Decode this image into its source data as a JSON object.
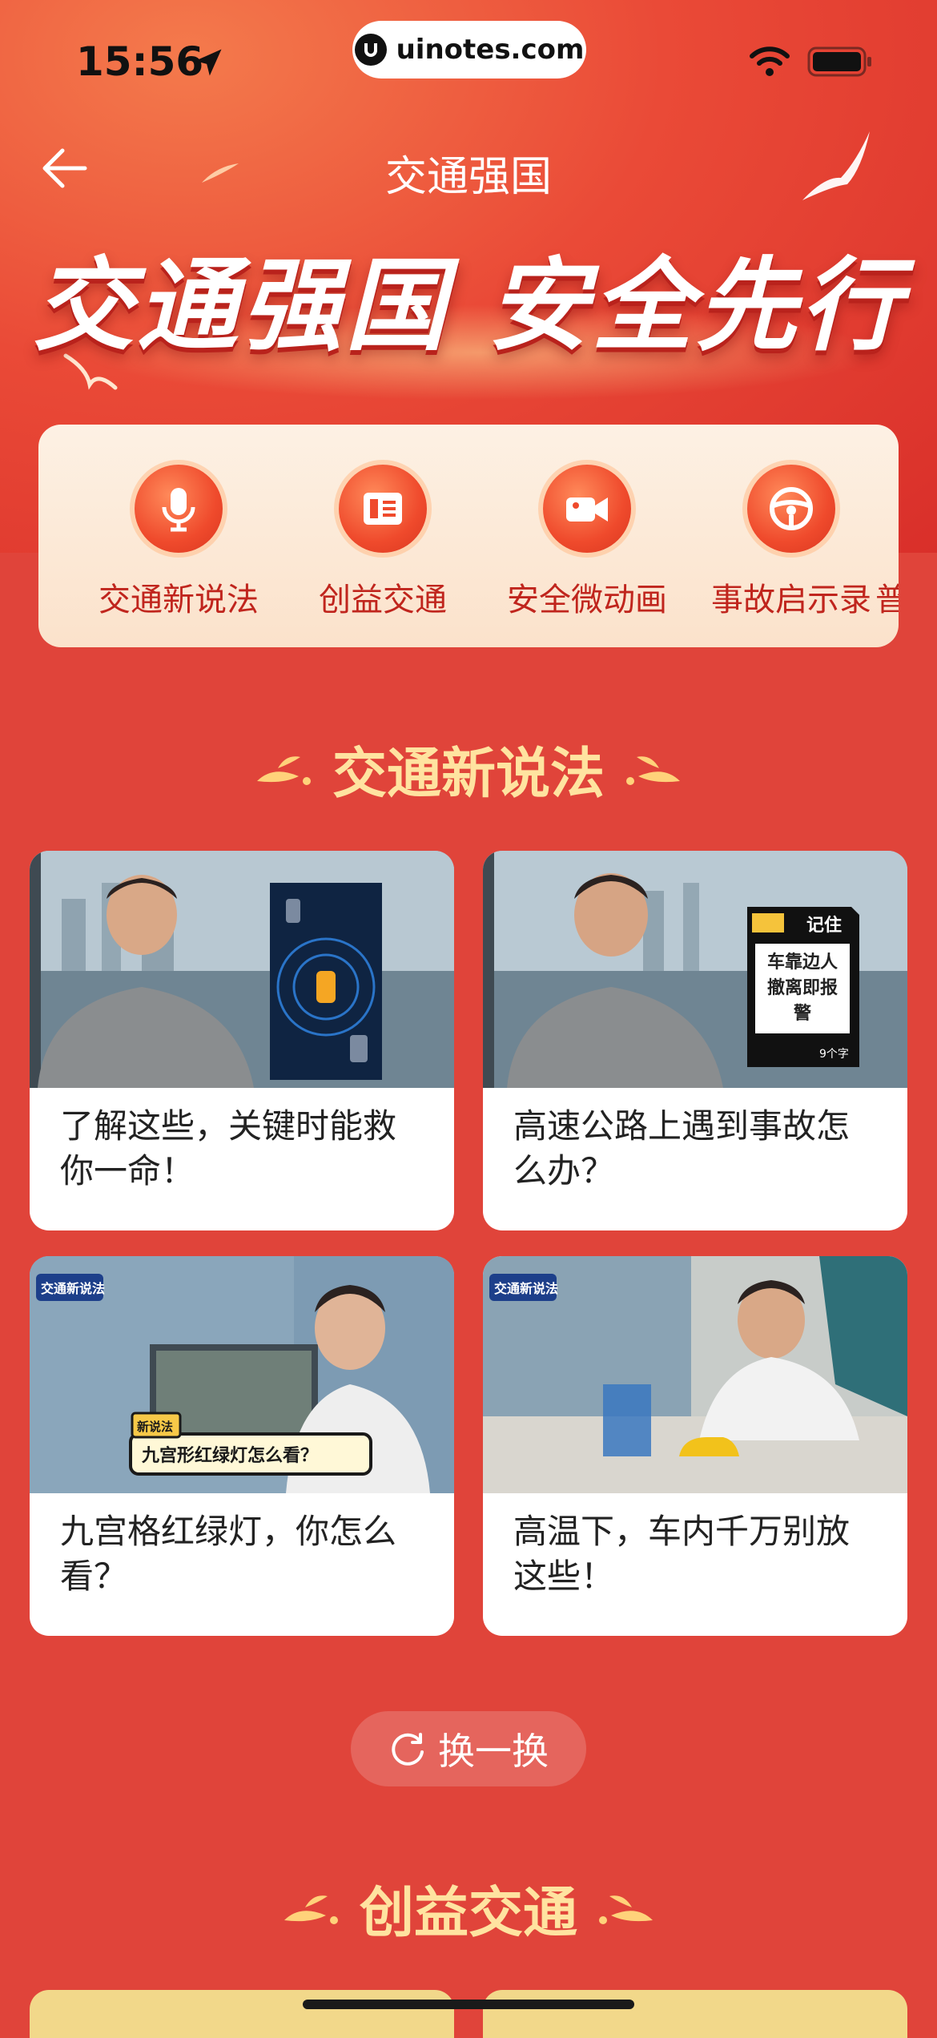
{
  "status_bar": {
    "time": "15:56",
    "url": "uinotes.com"
  },
  "nav": {
    "title": "交通强国"
  },
  "hero": {
    "title": "交通强国 安全先行"
  },
  "categories": [
    {
      "label": "交通新说法",
      "icon": "microphone-icon"
    },
    {
      "label": "创益交通",
      "icon": "ticket-icon"
    },
    {
      "label": "安全微动画",
      "icon": "video-camera-icon"
    },
    {
      "label": "事故启示录",
      "icon": "steering-wheel-icon"
    },
    {
      "label": "普",
      "icon": ""
    }
  ],
  "section1": {
    "title": "交通新说法"
  },
  "videos": [
    {
      "title": "了解这些，关键时能救你一命！"
    },
    {
      "title": "高速公路上遇到事故怎么办？"
    },
    {
      "title": "九宫格红绿灯，你怎么看？"
    },
    {
      "title": "高温下，车内千万别放这些！"
    }
  ],
  "thumb_text": {
    "note_title": "记住",
    "note_body": "车靠边人撤离即报警",
    "note_foot": "9个字",
    "badge": "交通新说法",
    "banner": "九宫形红绿灯怎么看？",
    "banner_tag": "新说法"
  },
  "refresh": {
    "label": "换一换"
  },
  "section2": {
    "title": "创益交通"
  },
  "colors": {
    "background": "#e0443a",
    "accent_gold": "#ffe3a0",
    "category_text": "#c0251d"
  }
}
